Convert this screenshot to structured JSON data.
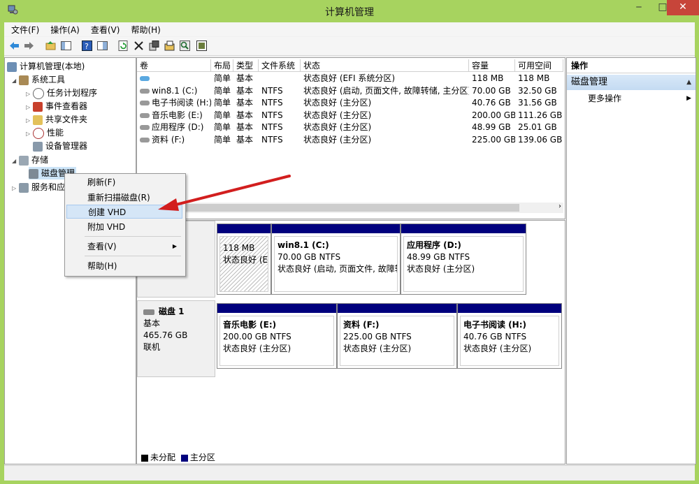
{
  "window": {
    "title": "计算机管理",
    "minimize": "‒",
    "maximize": "□",
    "close": "✕"
  },
  "menu": [
    "文件(F)",
    "操作(A)",
    "查看(V)",
    "帮助(H)"
  ],
  "toolbar": [
    "back-icon",
    "forward-icon",
    "up-folder-icon",
    "show-hide-tree-icon",
    "help-icon",
    "properties-pane-icon",
    "refresh-icon",
    "delete-icon",
    "properties-icon",
    "open-icon",
    "search-icon",
    "wizard-icon"
  ],
  "tree": {
    "root": "计算机管理(本地)",
    "system_tools": "系统工具",
    "task_scheduler": "任务计划程序",
    "event_viewer": "事件查看器",
    "shared_folders": "共享文件夹",
    "performance": "性能",
    "device_manager": "设备管理器",
    "storage": "存储",
    "disk_management": "磁盘管理",
    "services": "服务和应"
  },
  "volumes": {
    "columns": [
      "卷",
      "布局",
      "类型",
      "文件系统",
      "状态",
      "容量",
      "可用空间"
    ],
    "rows": [
      {
        "name": "",
        "layout": "简单",
        "type": "基本",
        "fs": "",
        "status": "状态良好 (EFI 系统分区)",
        "capacity": "118 MB",
        "free": "118 MB"
      },
      {
        "name": "win8.1 (C:)",
        "layout": "简单",
        "type": "基本",
        "fs": "NTFS",
        "status": "状态良好 (启动, 页面文件, 故障转储, 主分区)",
        "capacity": "70.00 GB",
        "free": "32.50 GB"
      },
      {
        "name": "电子书阅读 (H:)",
        "layout": "简单",
        "type": "基本",
        "fs": "NTFS",
        "status": "状态良好 (主分区)",
        "capacity": "40.76 GB",
        "free": "31.56 GB"
      },
      {
        "name": "音乐电影 (E:)",
        "layout": "简单",
        "type": "基本",
        "fs": "NTFS",
        "status": "状态良好 (主分区)",
        "capacity": "200.00 GB",
        "free": "111.26 GB"
      },
      {
        "name": "应用程序 (D:)",
        "layout": "简单",
        "type": "基本",
        "fs": "NTFS",
        "status": "状态良好 (主分区)",
        "capacity": "48.99 GB",
        "free": "25.01 GB"
      },
      {
        "name": "资料 (F:)",
        "layout": "简单",
        "type": "基本",
        "fs": "NTFS",
        "status": "状态良好 (主分区)",
        "capacity": "225.00 GB",
        "free": "139.06 GB"
      }
    ]
  },
  "disk0": {
    "parts": [
      {
        "line2": "118 MB",
        "line3": "状态良好 (EFI"
      },
      {
        "name": "win8.1  (C:)",
        "line2": "70.00 GB NTFS",
        "line3": "状态良好 (启动, 页面文件, 故障转"
      },
      {
        "name": "应用程序  (D:)",
        "line2": "48.99 GB NTFS",
        "line3": "状态良好 (主分区)"
      }
    ]
  },
  "disk1": {
    "name": "磁盘 1",
    "type": "基本",
    "size": "465.76 GB",
    "state": "联机",
    "parts": [
      {
        "name": "音乐电影  (E:)",
        "line2": "200.00 GB NTFS",
        "line3": "状态良好 (主分区)"
      },
      {
        "name": "资料  (F:)",
        "line2": "225.00 GB NTFS",
        "line3": "状态良好 (主分区)"
      },
      {
        "name": "电子书阅读  (H:)",
        "line2": "40.76 GB NTFS",
        "line3": "状态良好 (主分区)"
      }
    ]
  },
  "legend": {
    "unallocated": "未分配",
    "primary": "主分区"
  },
  "actions": {
    "title": "操作",
    "section": "磁盘管理",
    "more": "更多操作"
  },
  "context_menu": {
    "refresh": "刷新(F)",
    "rescan": "重新扫描磁盘(R)",
    "create_vhd": "创建 VHD",
    "attach_vhd": "附加 VHD",
    "view": "查看(V)",
    "help": "帮助(H)"
  },
  "colors": {
    "primary_partition": "#00007d",
    "unallocated": "#000000",
    "window_frame": "#a7d35f",
    "arrow": "#d21e1e"
  }
}
